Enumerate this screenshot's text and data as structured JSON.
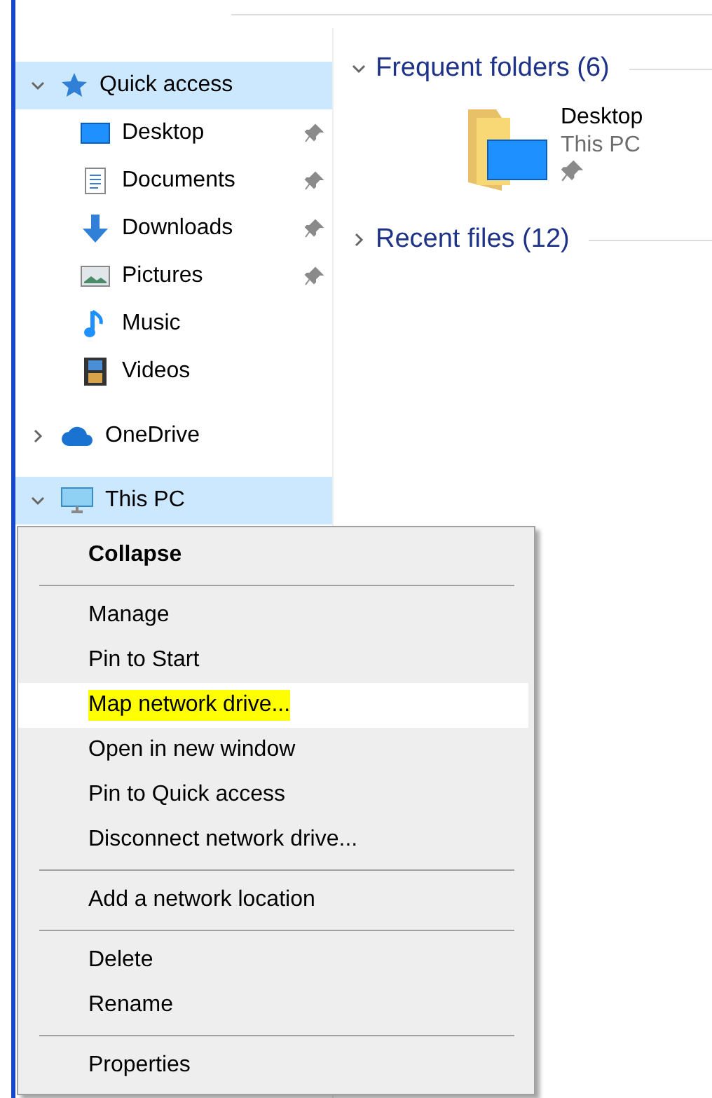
{
  "sidebar": {
    "items": [
      {
        "label": "Quick access",
        "expanded": true,
        "selected": true,
        "children": [
          {
            "label": "Desktop",
            "pinned": true
          },
          {
            "label": "Documents",
            "pinned": true
          },
          {
            "label": "Downloads",
            "pinned": true
          },
          {
            "label": "Pictures",
            "pinned": true
          },
          {
            "label": "Music",
            "pinned": false
          },
          {
            "label": "Videos",
            "pinned": false
          }
        ]
      },
      {
        "label": "OneDrive",
        "expanded": false,
        "selected": false
      },
      {
        "label": "This PC",
        "expanded": true,
        "selected": true
      }
    ]
  },
  "main": {
    "sections": [
      {
        "title": "Frequent folders (6)",
        "expanded": true,
        "folders": [
          {
            "name": "Desktop",
            "location": "This PC",
            "pinned": true
          }
        ]
      },
      {
        "title": "Recent files (12)",
        "expanded": false
      }
    ]
  },
  "context_menu": {
    "groups": [
      [
        {
          "label": "Collapse",
          "default": true,
          "selected": false,
          "marked": false
        }
      ],
      [
        {
          "label": "Manage",
          "default": false,
          "selected": false,
          "marked": false
        },
        {
          "label": "Pin to Start",
          "default": false,
          "selected": false,
          "marked": false
        },
        {
          "label": "Map network drive...",
          "default": false,
          "selected": true,
          "marked": true
        },
        {
          "label": "Open in new window",
          "default": false,
          "selected": false,
          "marked": false
        },
        {
          "label": "Pin to Quick access",
          "default": false,
          "selected": false,
          "marked": false
        },
        {
          "label": "Disconnect network drive...",
          "default": false,
          "selected": false,
          "marked": false
        }
      ],
      [
        {
          "label": "Add a network location",
          "default": false,
          "selected": false,
          "marked": false
        }
      ],
      [
        {
          "label": "Delete",
          "default": false,
          "selected": false,
          "marked": false
        },
        {
          "label": "Rename",
          "default": false,
          "selected": false,
          "marked": false
        }
      ],
      [
        {
          "label": "Properties",
          "default": false,
          "selected": false,
          "marked": false
        }
      ]
    ]
  }
}
